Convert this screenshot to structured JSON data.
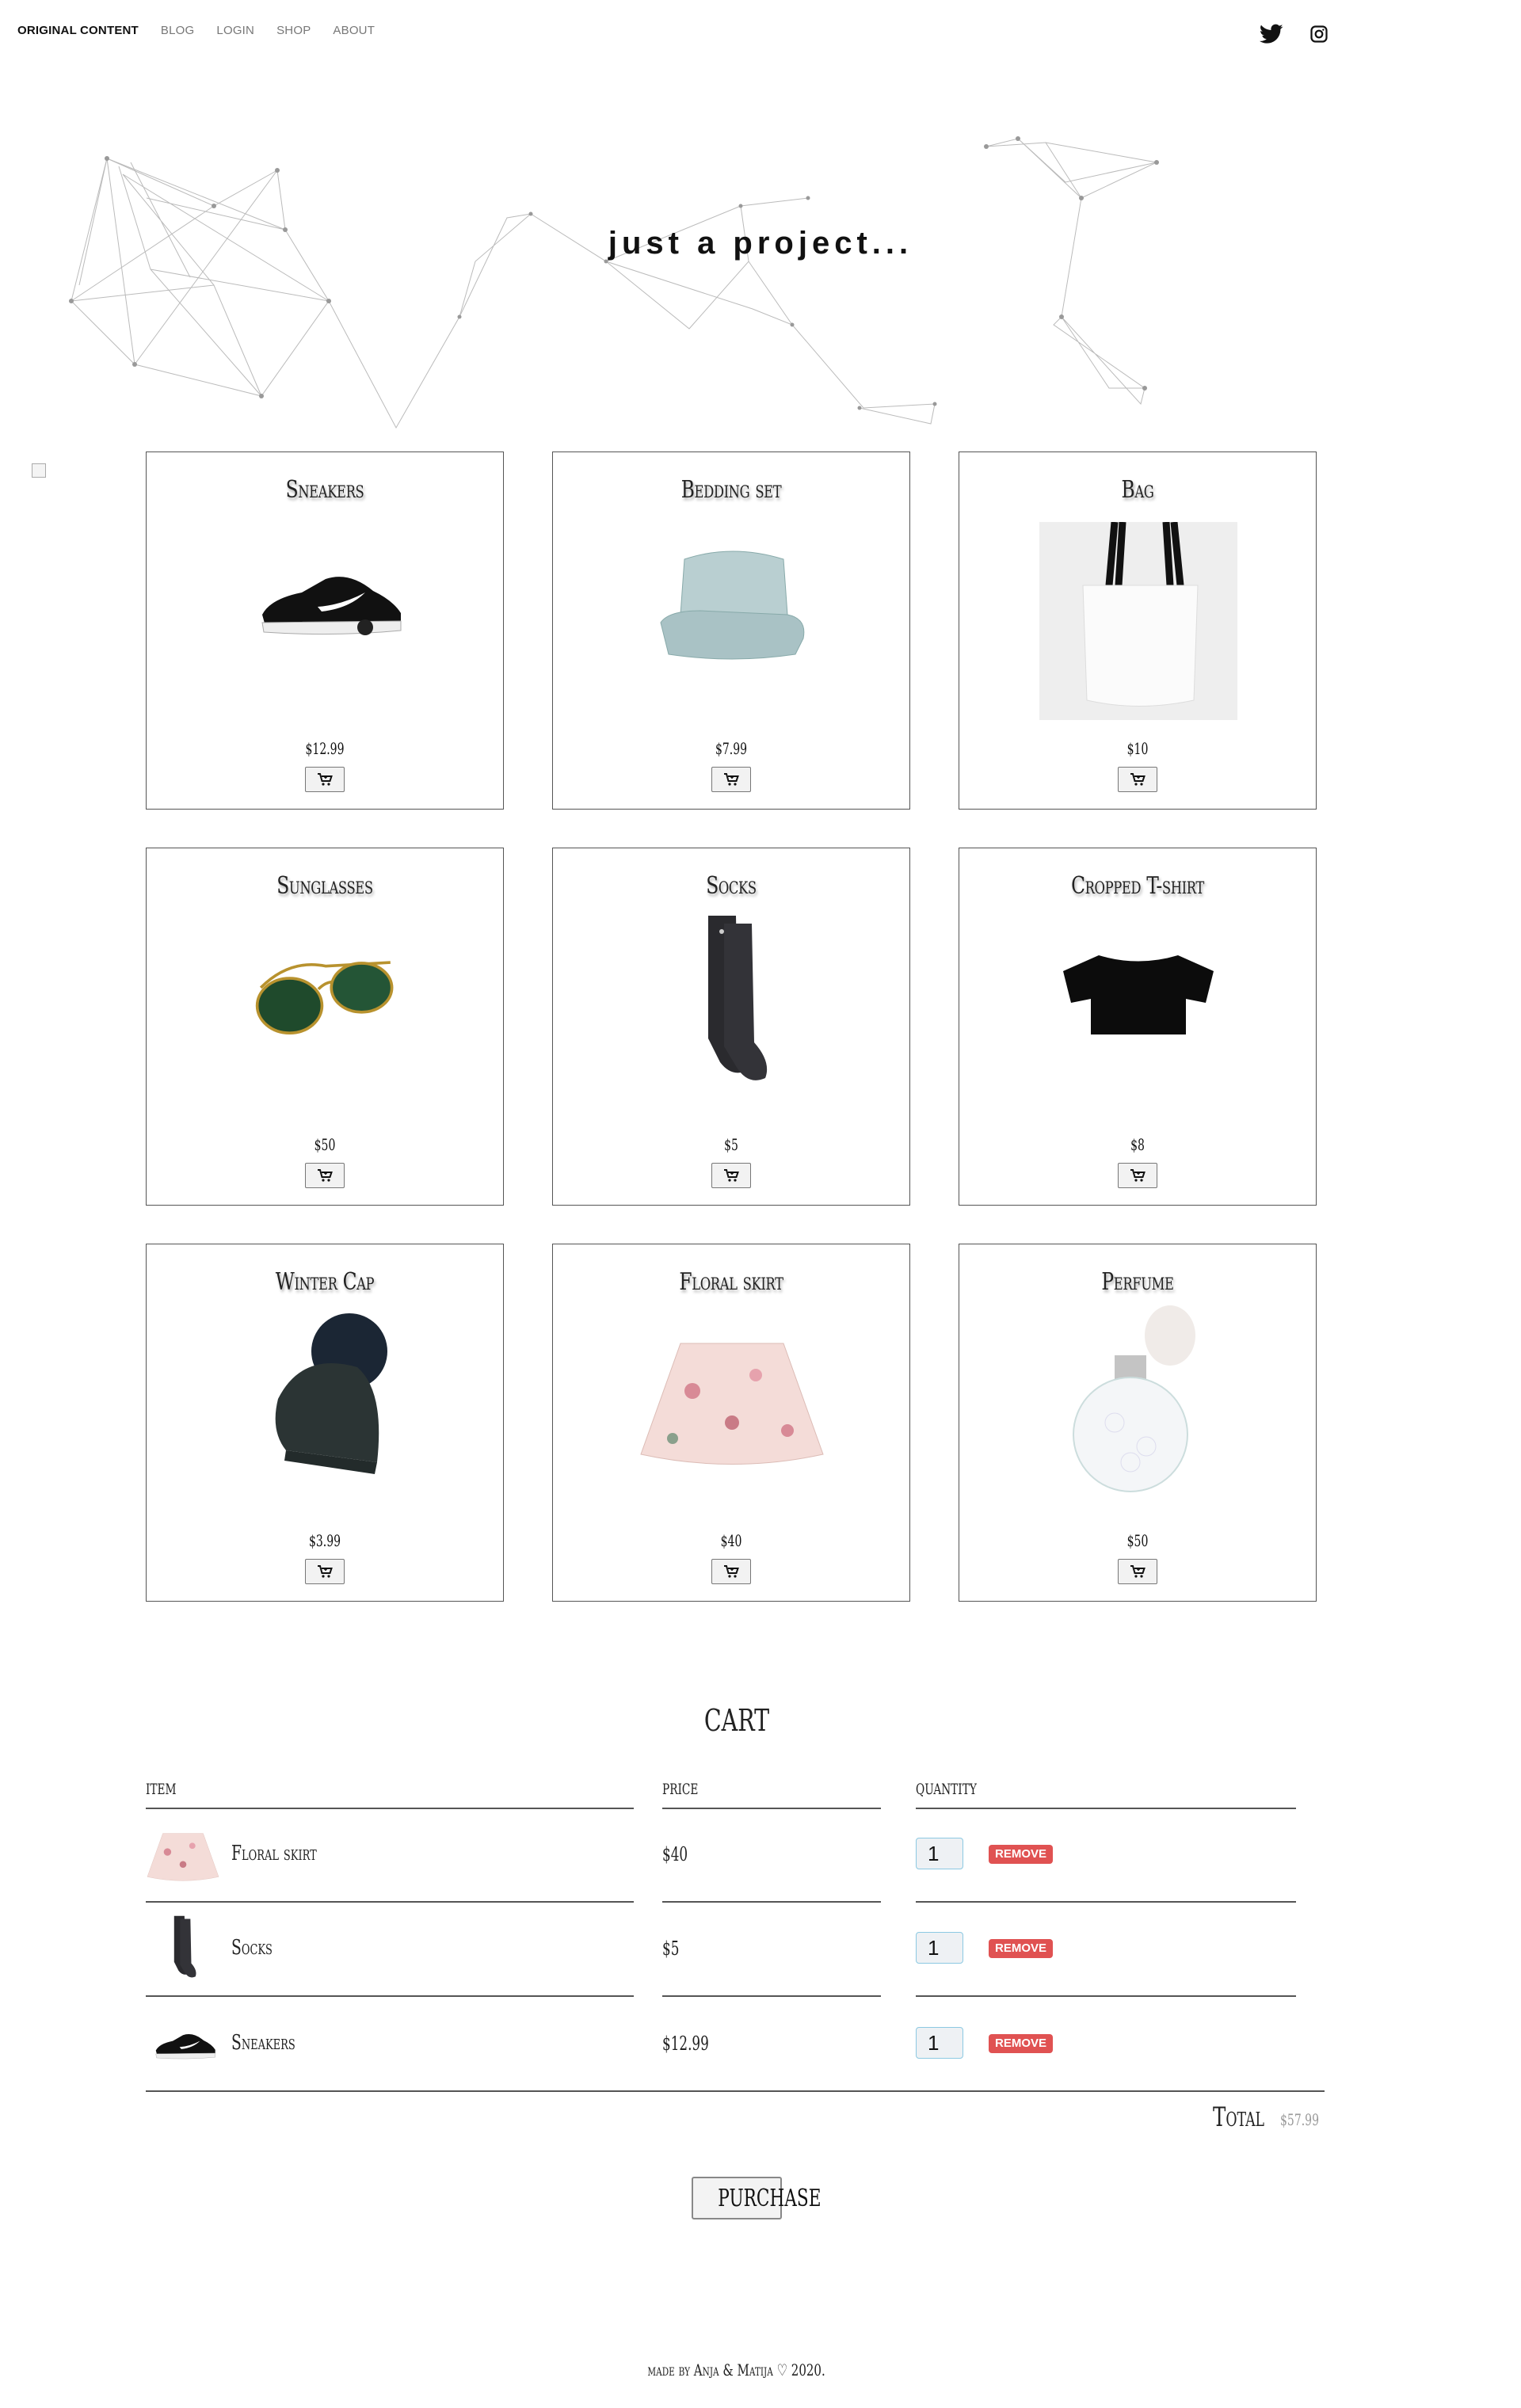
{
  "nav": {
    "brand": "ORIGINAL CONTENT",
    "links": [
      "BLOG",
      "LOGIN",
      "SHOP",
      "ABOUT"
    ],
    "social_icons": [
      "twitter-icon",
      "instagram-icon"
    ]
  },
  "hero": {
    "title": "just a project..."
  },
  "products": [
    {
      "name": "Sneakers",
      "price": "$12.99",
      "icon": "sneaker-image"
    },
    {
      "name": "Bedding set",
      "price": "$7.99",
      "icon": "bedding-image"
    },
    {
      "name": "Bag",
      "price": "$10",
      "icon": "tote-bag-image"
    },
    {
      "name": "Sunglasses",
      "price": "$50",
      "icon": "sunglasses-image"
    },
    {
      "name": "Socks",
      "price": "$5",
      "icon": "socks-image"
    },
    {
      "name": "Cropped T-shirt",
      "price": "$8",
      "icon": "tshirt-image"
    },
    {
      "name": "Winter Cap",
      "price": "$3.99",
      "icon": "winter-cap-image"
    },
    {
      "name": "Floral skirt",
      "price": "$40",
      "icon": "skirt-image"
    },
    {
      "name": "Perfume",
      "price": "$50",
      "icon": "perfume-image"
    }
  ],
  "cart": {
    "title": "CART",
    "headers": {
      "item": "ITEM",
      "price": "PRICE",
      "quantity": "QUANTITY"
    },
    "rows": [
      {
        "name": "Floral skirt",
        "price": "$40",
        "quantity": "1",
        "remove": "REMOVE"
      },
      {
        "name": "Socks",
        "price": "$5",
        "quantity": "1",
        "remove": "REMOVE"
      },
      {
        "name": "Sneakers",
        "price": "$12.99",
        "quantity": "1",
        "remove": "REMOVE"
      }
    ],
    "total_label": "Total",
    "total_value": "$57.99",
    "purchase": "PURCHASE"
  },
  "footer": {
    "text": "made by Anja & Matija ♡ 2020."
  },
  "colors": {
    "remove": "#e05252",
    "qty_border": "#8cc9e2"
  }
}
